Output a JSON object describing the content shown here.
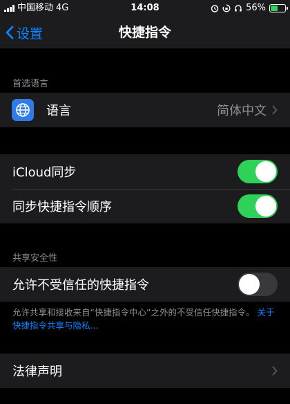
{
  "status_bar": {
    "carrier": "中国移动",
    "network": "4G",
    "time": "14:08",
    "battery_percent": "56%",
    "battery_level": 0.56
  },
  "nav": {
    "back_label": "设置",
    "title": "快捷指令"
  },
  "sections": {
    "language_header": "首选语言",
    "language_row": {
      "label": "语言",
      "value": "简体中文"
    },
    "sync_rows": [
      {
        "label": "iCloud同步",
        "state": "on"
      },
      {
        "label": "同步快捷指令顺序",
        "state": "on"
      }
    ],
    "security_header": "共享安全性",
    "security_row": {
      "label": "允许不受信任的快捷指令",
      "state": "off"
    },
    "security_note": "允许共享和接收来自“快捷指令中心”之外的不受信任快捷指令。",
    "security_link": "关于快捷指令共享与隐私...",
    "legal_row": {
      "label": "法律声明"
    }
  },
  "colors": {
    "accent": "#0a84ff",
    "toggle_on": "#30d158",
    "toggle_off": "#39393d",
    "background": "#000000",
    "cell": "#1c1c1e"
  }
}
